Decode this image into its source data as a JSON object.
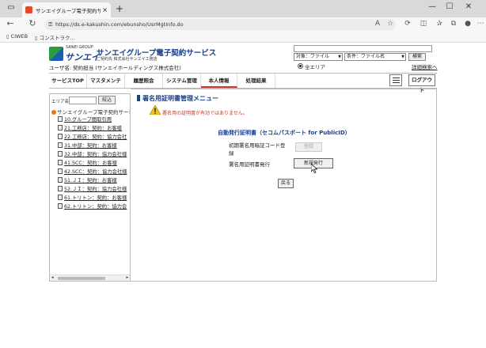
{
  "browser": {
    "tab_title": "サンエイグループ電子契約サービス",
    "tab_close": "×",
    "new_tab": "+",
    "url": "https://ds.e-kakushin.com/ebunsho/UsrMgtInfo.do",
    "bookmarks": [
      "CIWEB",
      "コンストラク..."
    ],
    "controls": {
      "minimize": "—",
      "maximize": "☐",
      "close": "✕"
    },
    "nav": {
      "back": "←",
      "refresh": "↻",
      "lock": "🔒"
    }
  },
  "header": {
    "logo_sub": "SANEI GROUP",
    "logo_brand": "サンエイ",
    "title": "サンエイグループ電子契約サービス",
    "company": "ご契約先 株式会社サンエイ工務店",
    "user_line": "ユーザ名: 契約担当 (サンエイホールディングス株式会社)"
  },
  "search": {
    "target_label": "対象：ファイル",
    "condition_label": "条件：ファイル名",
    "search_button": "検索",
    "area_label": "全エリア",
    "advanced_link": "詳細検索へ"
  },
  "nav": {
    "items": [
      "サービスTOP",
      "マスタメンテ",
      "履歴照会",
      "システム管理",
      "本人情報",
      "処理結果"
    ],
    "active_index": 4,
    "logout": "ログアウト"
  },
  "sidebar": {
    "area_label": "エリア名",
    "search_button": "絞込",
    "root": "サンエイグループ電子契約サービ",
    "items": [
      "10.グループ間取引用",
      "21.工務店：契約：お客様",
      "22.工務店：契約：協力会社",
      "31.中部：契約：お客様",
      "32.中部：契約：協力会社様",
      "41.SCC：契約：お客様",
      "42.SCC：契約：協力会社様",
      "51.ＪＩ：契約：お客様",
      "52.ＪＩ：契約：協力会社様",
      "61.トリトン：契約：お客様",
      "62.トリトン：契約：協力会"
    ]
  },
  "main": {
    "title": "署名用証明書管理メニュー",
    "warning": "署名用の証明書が有効ではありません。",
    "section_title": "自動発行証明書（セコムパスポート for PublicID）",
    "row1_label_a": "初期署名用暗証コード登",
    "row1_label_b": "録",
    "row1_button": "登録",
    "row2_label": "署名用証明書発行",
    "row2_button": "新規発行",
    "back_button": "戻る"
  },
  "colors": {
    "accent": "#1a3f8a",
    "warning": "#c0392b",
    "active_tab": "#c0392b"
  }
}
